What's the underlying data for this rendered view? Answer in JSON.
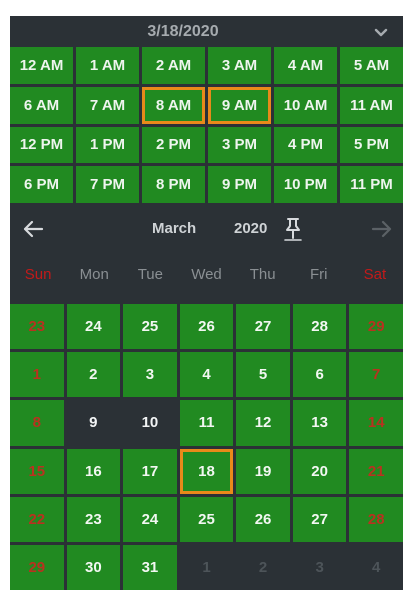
{
  "header": {
    "date": "3/18/2020"
  },
  "hours": [
    {
      "label": "12 AM"
    },
    {
      "label": "1 AM"
    },
    {
      "label": "2 AM"
    },
    {
      "label": "3 AM"
    },
    {
      "label": "4 AM"
    },
    {
      "label": "5 AM"
    },
    {
      "label": "6 AM"
    },
    {
      "label": "7 AM"
    },
    {
      "label": "8 AM",
      "selected": true
    },
    {
      "label": "9 AM",
      "selected": true
    },
    {
      "label": "10 AM"
    },
    {
      "label": "11 AM"
    },
    {
      "label": "12 PM"
    },
    {
      "label": "1 PM"
    },
    {
      "label": "2 PM"
    },
    {
      "label": "3 PM"
    },
    {
      "label": "4 PM"
    },
    {
      "label": "5 PM"
    },
    {
      "label": "6 PM"
    },
    {
      "label": "7 PM"
    },
    {
      "label": "8 PM"
    },
    {
      "label": "9 PM"
    },
    {
      "label": "10 PM"
    },
    {
      "label": "11 PM"
    }
  ],
  "nav": {
    "prev_icon": "arrow-left-icon",
    "next_icon": "arrow-right-icon",
    "pin_icon": "pin-icon",
    "month": "March",
    "year": "2020"
  },
  "weekdays": [
    {
      "label": "Sun",
      "weekend": true
    },
    {
      "label": "Mon"
    },
    {
      "label": "Tue"
    },
    {
      "label": "Wed"
    },
    {
      "label": "Thu"
    },
    {
      "label": "Fri"
    },
    {
      "label": "Sat",
      "weekend": true
    }
  ],
  "days": [
    {
      "label": "23",
      "weekend": true
    },
    {
      "label": "24"
    },
    {
      "label": "25"
    },
    {
      "label": "26"
    },
    {
      "label": "27"
    },
    {
      "label": "28"
    },
    {
      "label": "29",
      "weekend": true
    },
    {
      "label": "1",
      "weekend": true
    },
    {
      "label": "2"
    },
    {
      "label": "3"
    },
    {
      "label": "4"
    },
    {
      "label": "5"
    },
    {
      "label": "6"
    },
    {
      "label": "7",
      "weekend": true
    },
    {
      "label": "8",
      "weekend": true
    },
    {
      "label": "9",
      "state": "dark"
    },
    {
      "label": "10",
      "state": "dark"
    },
    {
      "label": "11"
    },
    {
      "label": "12"
    },
    {
      "label": "13"
    },
    {
      "label": "14",
      "weekend": true
    },
    {
      "label": "15",
      "weekend": true
    },
    {
      "label": "16"
    },
    {
      "label": "17"
    },
    {
      "label": "18",
      "selected": true
    },
    {
      "label": "19"
    },
    {
      "label": "20"
    },
    {
      "label": "21",
      "weekend": true
    },
    {
      "label": "22",
      "weekend": true
    },
    {
      "label": "23"
    },
    {
      "label": "24"
    },
    {
      "label": "25"
    },
    {
      "label": "26"
    },
    {
      "label": "27"
    },
    {
      "label": "28",
      "weekend": true
    },
    {
      "label": "29",
      "weekend": true
    },
    {
      "label": "30"
    },
    {
      "label": "31"
    },
    {
      "label": "1",
      "state": "out"
    },
    {
      "label": "2",
      "state": "out"
    },
    {
      "label": "3",
      "state": "out"
    },
    {
      "label": "4",
      "state": "out"
    }
  ],
  "colors": {
    "accent": "#218a21",
    "selection": "#e88a1a",
    "weekend": "#c21a1a",
    "background": "#2b3136"
  }
}
